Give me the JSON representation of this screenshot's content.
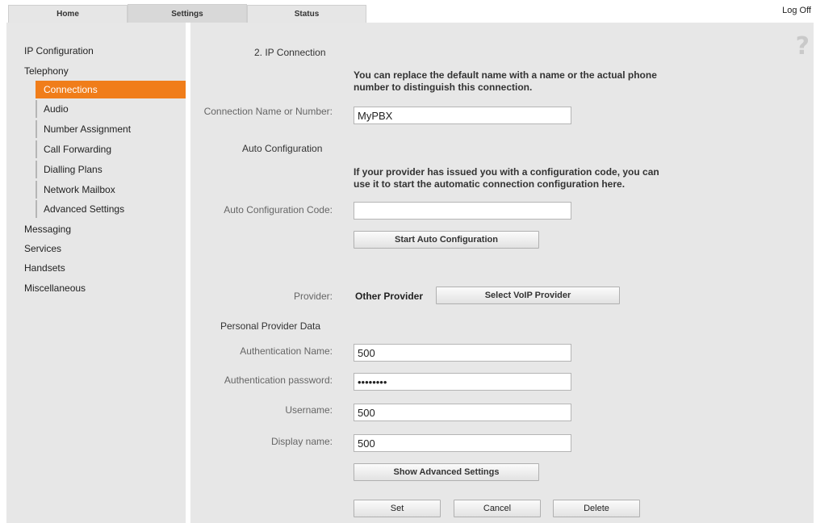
{
  "tabs": [
    {
      "label": "Home",
      "active": false
    },
    {
      "label": "Settings",
      "active": true
    },
    {
      "label": "Status",
      "active": false
    }
  ],
  "header": {
    "logoff_label": "Log Off"
  },
  "sidebar": {
    "items": [
      {
        "label": "IP Configuration"
      },
      {
        "label": "Telephony"
      },
      {
        "label": "Connections",
        "active": true
      },
      {
        "label": "Audio"
      },
      {
        "label": "Number Assignment"
      },
      {
        "label": "Call Forwarding"
      },
      {
        "label": "Dialling Plans"
      },
      {
        "label": "Network Mailbox"
      },
      {
        "label": "Advanced Settings"
      },
      {
        "label": "Messaging"
      },
      {
        "label": "Services"
      },
      {
        "label": "Handsets"
      },
      {
        "label": "Miscellaneous"
      }
    ]
  },
  "main": {
    "help_glyph": "?",
    "ip_connection": {
      "title": "2. IP Connection",
      "info": "You can replace the default name with a name or the actual phone number to distinguish this connection.",
      "name_label": "Connection Name or Number:",
      "name_value": "MyPBX"
    },
    "auto_config": {
      "title": "Auto Configuration",
      "info": "If your provider has issued you with a configuration code, you can use it to start the automatic connection configuration here.",
      "code_label": "Auto Configuration Code:",
      "code_value": "",
      "start_button": "Start Auto Configuration"
    },
    "provider": {
      "label": "Provider:",
      "value": "Other Provider",
      "select_button": "Select VoIP Provider"
    },
    "personal": {
      "title": "Personal Provider Data",
      "auth_name_label": "Authentication Name:",
      "auth_name_value": "500",
      "auth_pw_label": "Authentication password:",
      "auth_pw_value": "secret12",
      "username_label": "Username:",
      "username_value": "500",
      "display_label": "Display name:",
      "display_value": "500",
      "advanced_button": "Show Advanced Settings"
    },
    "actions": {
      "set": "Set",
      "cancel": "Cancel",
      "delete": "Delete"
    }
  }
}
